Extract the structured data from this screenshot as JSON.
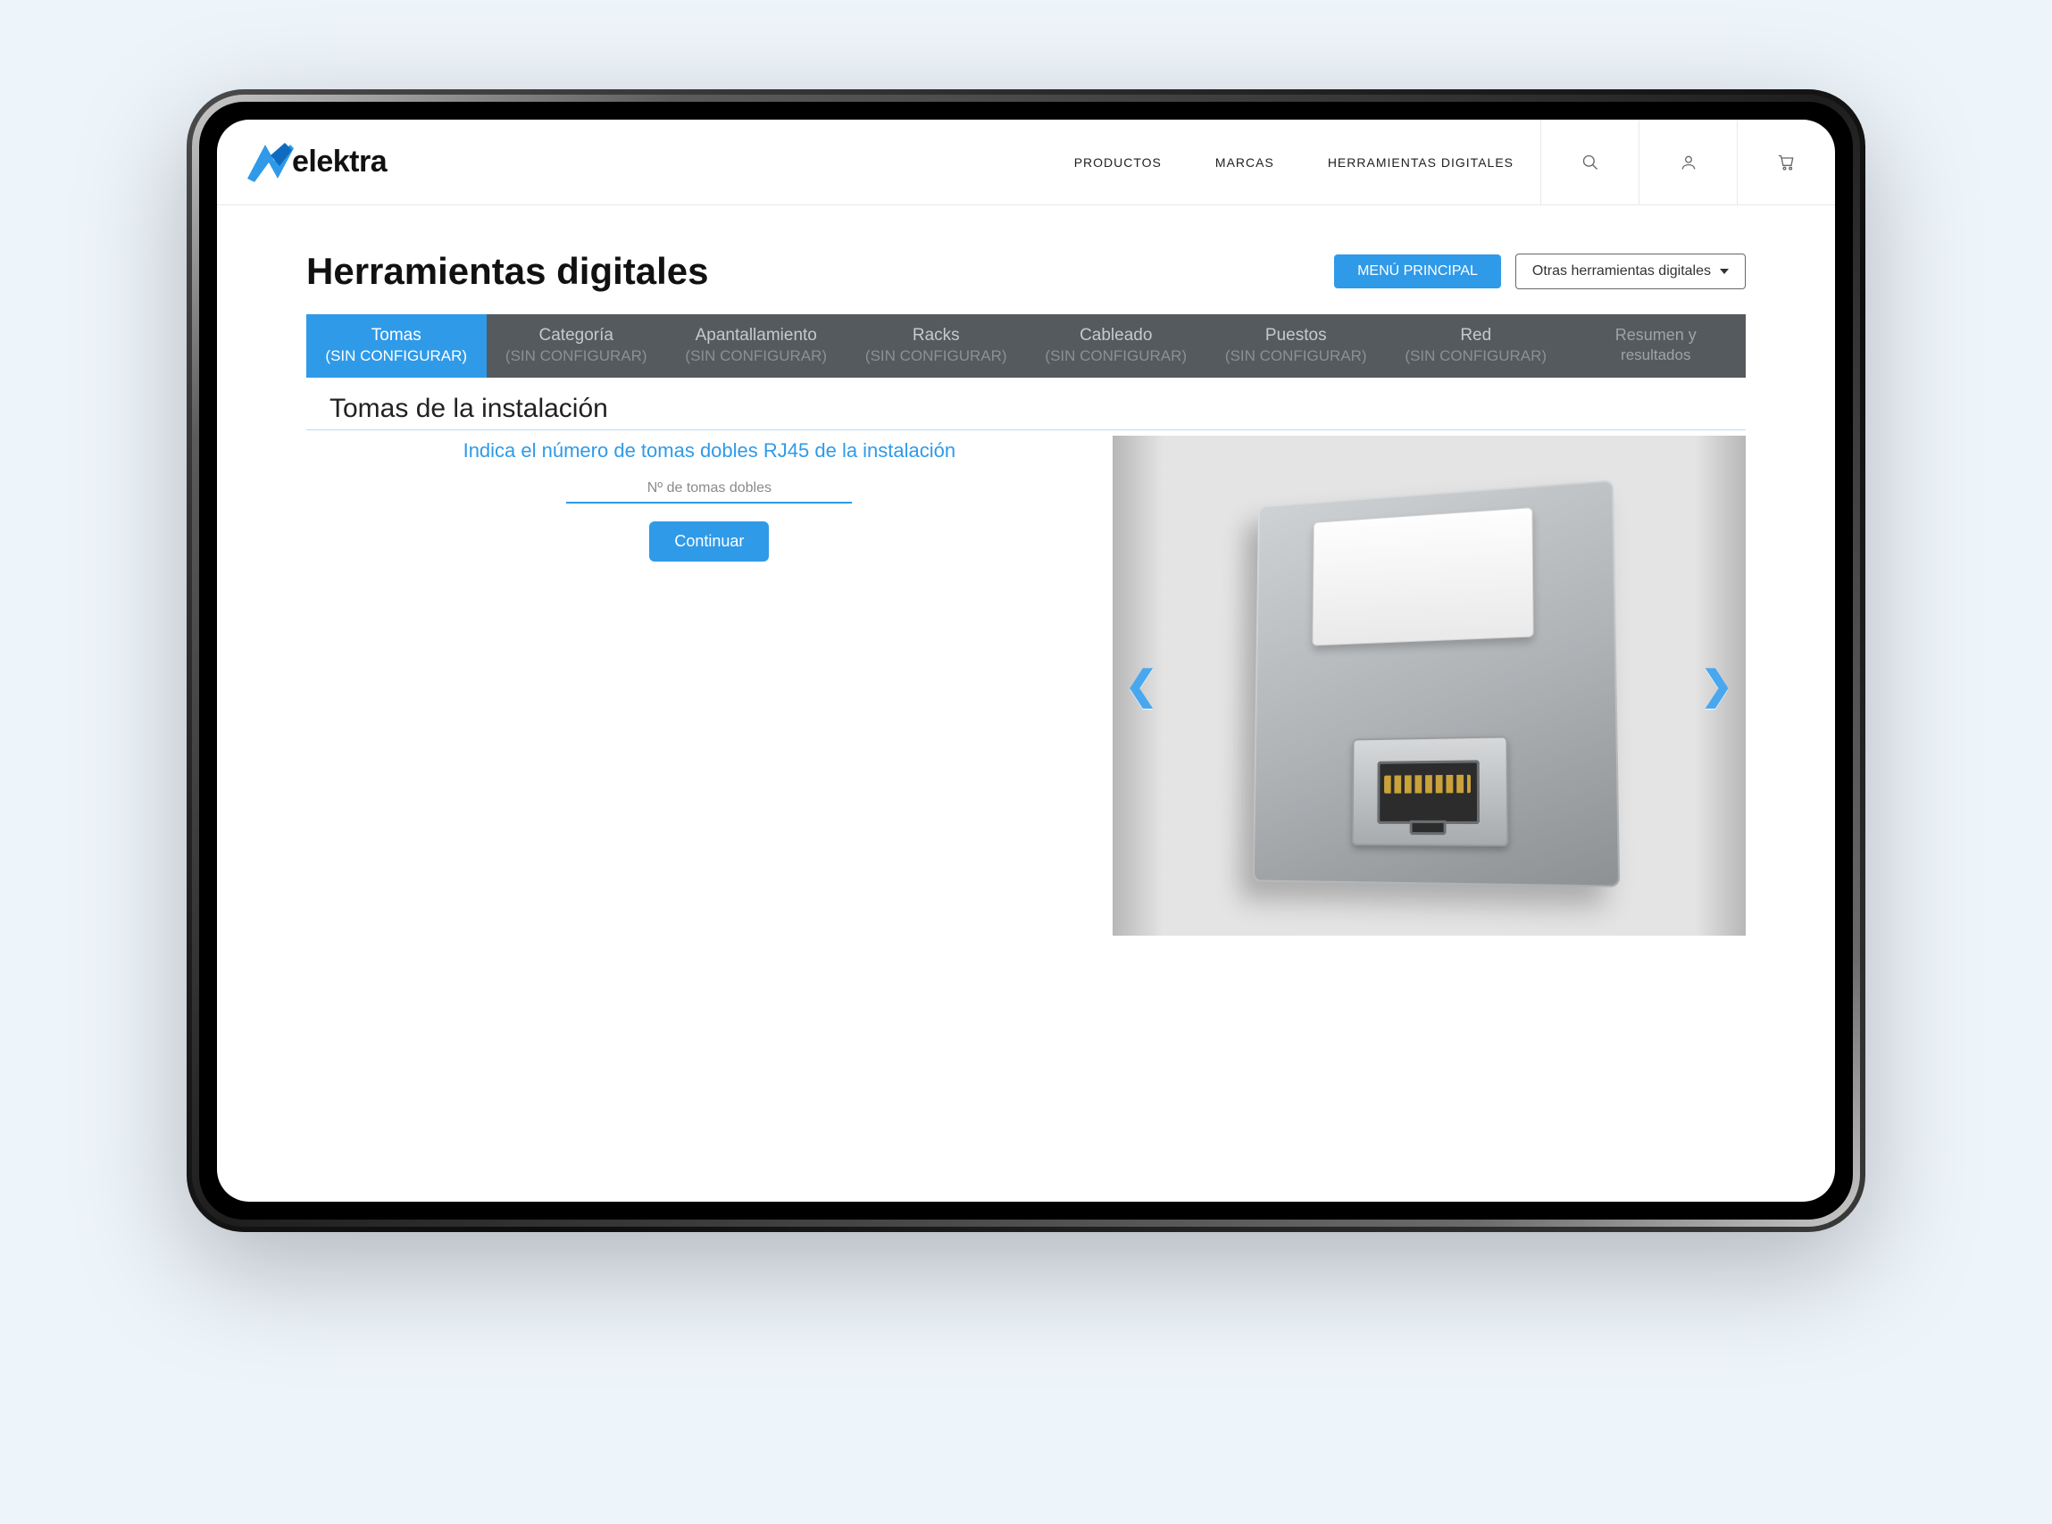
{
  "brand": {
    "name": "elektra"
  },
  "nav": {
    "items": [
      "PRODUCTOS",
      "MARCAS",
      "HERRAMIENTAS DIGITALES"
    ]
  },
  "page": {
    "title": "Herramientas digitales",
    "menu_button": "MENÚ PRINCIPAL",
    "other_tools_button": "Otras herramientas digitales"
  },
  "tabs": [
    {
      "main": "Tomas",
      "sub": "(SIN CONFIGURAR)",
      "active": true
    },
    {
      "main": "Categoría",
      "sub": "(SIN CONFIGURAR)",
      "active": false
    },
    {
      "main": "Apantallamiento",
      "sub": "(SIN CONFIGURAR)",
      "active": false
    },
    {
      "main": "Racks",
      "sub": "(SIN CONFIGURAR)",
      "active": false
    },
    {
      "main": "Cableado",
      "sub": "(SIN CONFIGURAR)",
      "active": false
    },
    {
      "main": "Puestos",
      "sub": "(SIN CONFIGURAR)",
      "active": false
    },
    {
      "main": "Red",
      "sub": "(SIN CONFIGURAR)",
      "active": false
    },
    {
      "main": "Resumen y",
      "sub": "resultados",
      "active": false,
      "last": true
    }
  ],
  "section": {
    "heading": "Tomas de la instalación",
    "prompt": "Indica el número de tomas dobles RJ45 de la instalación",
    "input_placeholder": "Nº de tomas dobles",
    "continue": "Continuar"
  }
}
